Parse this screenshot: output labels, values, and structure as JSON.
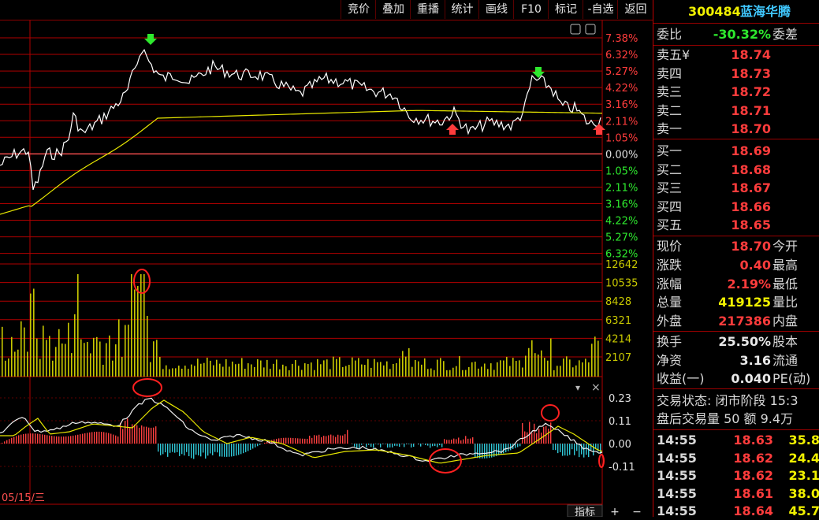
{
  "toolbar": {
    "buttons": [
      {
        "label": "竞价",
        "name": "auction-button"
      },
      {
        "label": "叠加",
        "name": "overlay-button"
      },
      {
        "label": "重播",
        "name": "replay-button"
      },
      {
        "label": "统计",
        "name": "statistics-button"
      },
      {
        "label": "画线",
        "name": "draw-line-button"
      },
      {
        "label": "F10",
        "name": "f10-button"
      },
      {
        "label": "标记",
        "name": "mark-button"
      },
      {
        "label": "-自选",
        "name": "remove-watchlist-button"
      },
      {
        "label": "返回",
        "name": "back-button"
      }
    ]
  },
  "stock": {
    "code": "300484",
    "name": "蓝海华腾"
  },
  "ratio": {
    "label": "委比",
    "value": "-30.32%",
    "label2": "委差"
  },
  "asks": [
    {
      "label": "卖五",
      "price": "18.74",
      "mark": "¥"
    },
    {
      "label": "卖四",
      "price": "18.73"
    },
    {
      "label": "卖三",
      "price": "18.72"
    },
    {
      "label": "卖二",
      "price": "18.71"
    },
    {
      "label": "卖一",
      "price": "18.70"
    }
  ],
  "bids": [
    {
      "label": "买一",
      "price": "18.69"
    },
    {
      "label": "买二",
      "price": "18.68"
    },
    {
      "label": "买三",
      "price": "18.67"
    },
    {
      "label": "买四",
      "price": "18.66"
    },
    {
      "label": "买五",
      "price": "18.65"
    }
  ],
  "quote": [
    {
      "label": "现价",
      "value": "18.70",
      "label2": "今开",
      "color": "red"
    },
    {
      "label": "涨跌",
      "value": "0.40",
      "label2": "最高",
      "color": "red"
    },
    {
      "label": "涨幅",
      "value": "2.19%",
      "label2": "最低",
      "color": "red"
    },
    {
      "label": "总量",
      "value": "419125",
      "label2": "量比",
      "color": "yellow"
    },
    {
      "label": "外盘",
      "value": "217386",
      "label2": "内盘",
      "color": "red"
    }
  ],
  "stats": [
    {
      "label": "换手",
      "value": "25.50%",
      "label2": "股本"
    },
    {
      "label": "净资",
      "value": "3.16",
      "label2": "流通"
    },
    {
      "label": "收益(一)",
      "value": "0.040",
      "label2": "PE(动)"
    }
  ],
  "trade_status": "交易状态: 闭市阶段 15:3",
  "after_hours": "盘后交易量 50 额 9.4万",
  "ticks": [
    {
      "time": "14:55",
      "price": "18.63",
      "vol": "35.8"
    },
    {
      "time": "14:55",
      "price": "18.62",
      "vol": "24.4"
    },
    {
      "time": "14:55",
      "price": "18.62",
      "vol": "23.1"
    },
    {
      "time": "14:55",
      "price": "18.61",
      "vol": "38.0"
    },
    {
      "time": "14:55",
      "price": "18.64",
      "vol": "45.7"
    }
  ],
  "chart_area": {
    "date_label": "05/15/三",
    "indicator_label": "指标",
    "plus_label": "+",
    "minus_label": "−",
    "price_pct_labels_up": [
      "7.38%",
      "6.32%",
      "5.27%",
      "4.22%",
      "3.16%",
      "2.11%",
      "1.05%"
    ],
    "zero_label": "0.00%",
    "price_pct_labels_down": [
      "1.05%",
      "2.11%",
      "3.16%",
      "4.22%",
      "5.27%",
      "6.32%"
    ],
    "volume_labels": [
      "12642",
      "10535",
      "8428",
      "6321",
      "4214",
      "2107"
    ],
    "macd_labels": [
      "0.23",
      "0.11",
      "0.00",
      "-0.11"
    ]
  },
  "colors": {
    "price_line": "#ffffff",
    "avg_line": "#e8e800",
    "grid": "#b00000",
    "up": "#ff3c3c",
    "down": "#2ee82e",
    "volume": "#c8c800",
    "macd_pos": "#ff4040",
    "macd_neg": "#30c8d8"
  }
}
